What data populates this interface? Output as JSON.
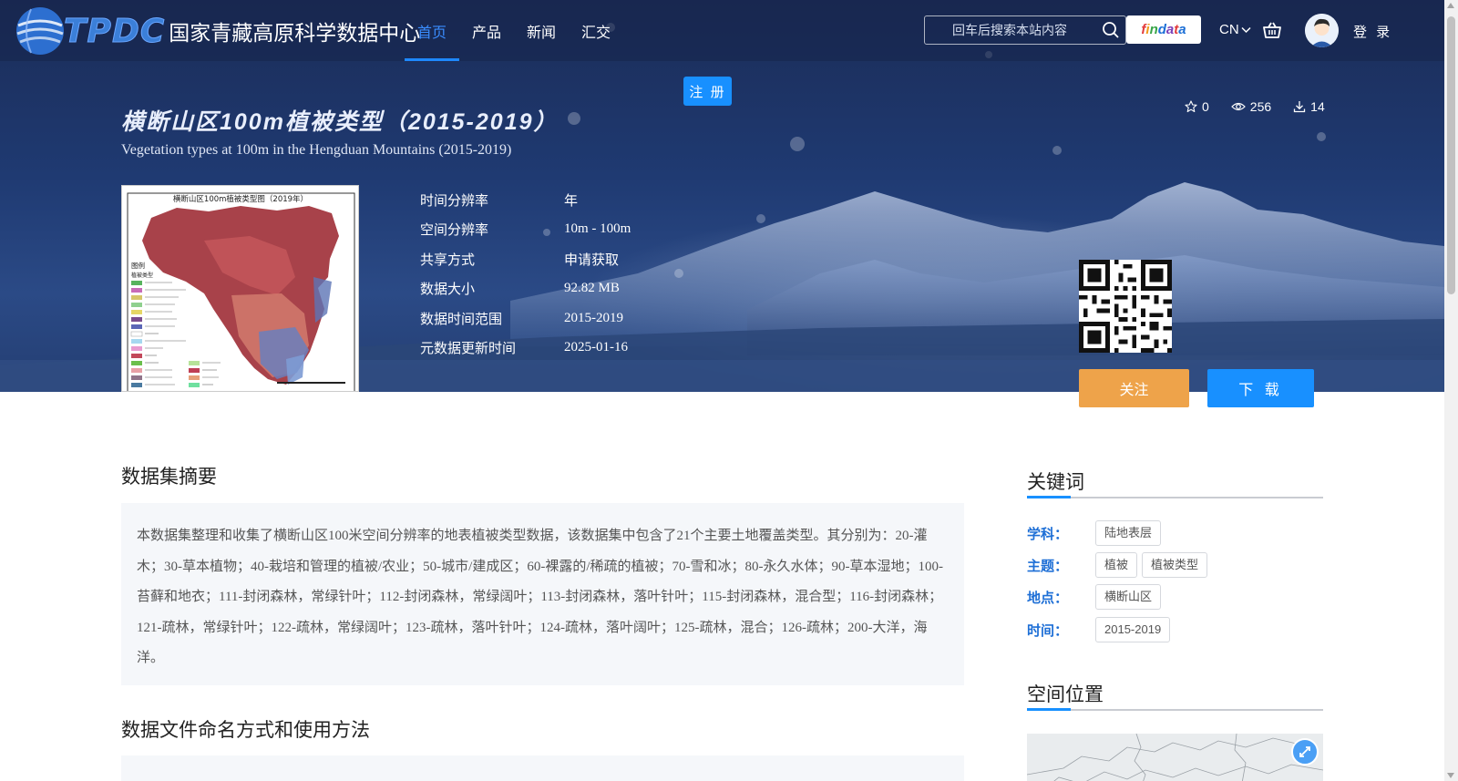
{
  "header": {
    "logo_text": "TPDC",
    "site_name": "国家青藏高原科学数据中心",
    "nav": [
      {
        "label": "首页",
        "active": true
      },
      {
        "label": "产品",
        "active": false
      },
      {
        "label": "新闻",
        "active": false
      },
      {
        "label": "汇交",
        "active": false
      }
    ],
    "search_placeholder": "回车后搜索本站内容",
    "findata_label": "findata",
    "lang": "CN",
    "login_label": "登 录",
    "register_label": "注 册"
  },
  "dataset": {
    "title_cn": "横断山区100m植被类型（2015-2019）",
    "title_en": "Vegetation types at 100m in the Hengduan Mountains (2015-2019)",
    "stats": {
      "stars": "0",
      "views": "256",
      "downloads": "14"
    },
    "metadata": [
      {
        "key": "时间分辨率",
        "value": "年"
      },
      {
        "key": "空间分辨率",
        "value": "10m - 100m"
      },
      {
        "key": "共享方式",
        "value": "申请获取"
      },
      {
        "key": "数据大小",
        "value": "92.82 MB"
      },
      {
        "key": "数据时间范围",
        "value": "2015-2019"
      },
      {
        "key": "元数据更新时间",
        "value": "2025-01-16"
      }
    ],
    "follow_label": "关注",
    "download_label": "下 载"
  },
  "thumbnail": {
    "title": "横断山区100m植被类型图（2019年）",
    "legend_title": "图例",
    "legend_subtitle": "植被类型"
  },
  "main": {
    "abstract_title": "数据集摘要",
    "abstract_text": "本数据集整理和收集了横断山区100米空间分辨率的地表植被类型数据，该数据集中包含了21个主要土地覆盖类型。其分别为：20-灌木；30-草本植物；40-栽培和管理的植被/农业；50-城市/建成区；60-裸露的/稀疏的植被；70-雪和冰；80-永久水体；90-草本湿地；100-苔藓和地衣；111-封闭森林，常绿针叶；112-封闭森林，常绿阔叶；113-封闭森林，落叶针叶；115-封闭森林，混合型；116-封闭森林；121-疏林，常绿针叶；122-疏林，常绿阔叶；123-疏林，落叶针叶；124-疏林，落叶阔叶；125-疏林，混合；126-疏林；200-大洋，海洋。",
    "naming_title": "数据文件命名方式和使用方法"
  },
  "sidebar": {
    "keywords_title": "关键词",
    "keywords": [
      {
        "label": "学科：",
        "tags": [
          "陆地表层"
        ]
      },
      {
        "label": "主题：",
        "tags": [
          "植被",
          "植被类型"
        ]
      },
      {
        "label": "地点：",
        "tags": [
          "横断山区"
        ]
      },
      {
        "label": "时间：",
        "tags": [
          "2015-2019"
        ]
      }
    ],
    "location_title": "空间位置"
  },
  "colors": {
    "accent": "#1890ff",
    "follow": "#eea34a",
    "keyword_label": "#1e6fd6",
    "hero": "#1f3a72"
  }
}
